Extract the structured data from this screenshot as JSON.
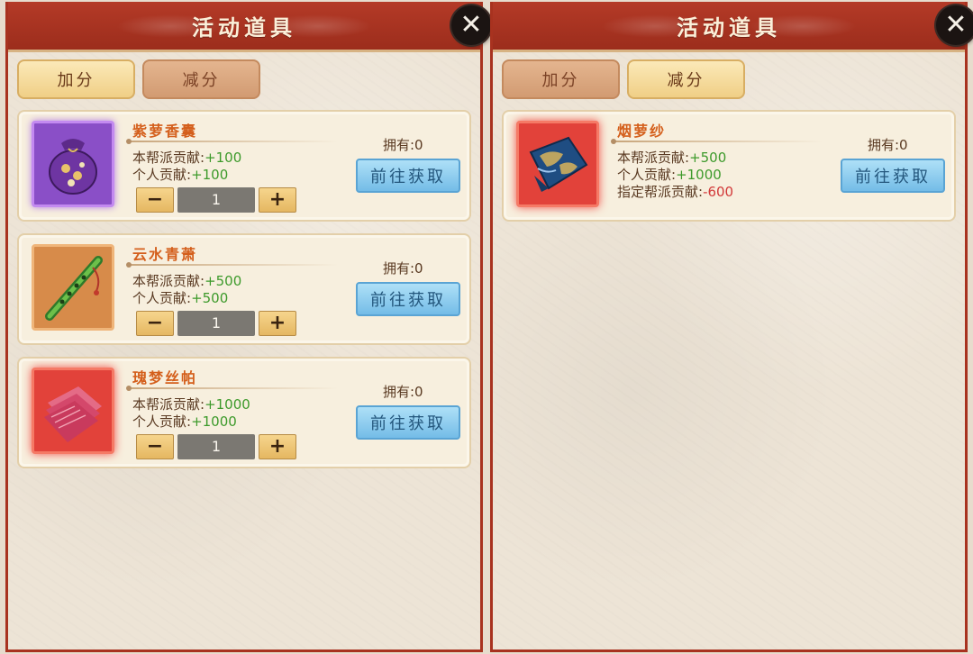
{
  "left_panel": {
    "title": "活动道具",
    "close_symbol": "✕",
    "tabs": [
      {
        "label": "加分",
        "state": "active"
      },
      {
        "label": "减分",
        "state": "inactive"
      }
    ],
    "items": [
      {
        "name": "紫萝香囊",
        "icon": "purple-sachet-icon",
        "stat1_label": "本帮派贡献:",
        "stat1_value": "+100",
        "stat2_label": "个人贡献:",
        "stat2_value": "+100",
        "owned": "拥有:0",
        "button": "前往获取",
        "quantity": "1",
        "minus": "−",
        "plus": "+"
      },
      {
        "name": "云水青萧",
        "icon": "green-flute-icon",
        "stat1_label": "本帮派贡献:",
        "stat1_value": "+500",
        "stat2_label": "个人贡献:",
        "stat2_value": "+500",
        "owned": "拥有:0",
        "button": "前往获取",
        "quantity": "1",
        "minus": "−",
        "plus": "+"
      },
      {
        "name": "瑰梦丝帕",
        "icon": "pink-silk-handkerchief-icon",
        "stat1_label": "本帮派贡献:",
        "stat1_value": "+1000",
        "stat2_label": "个人贡献:",
        "stat2_value": "+1000",
        "owned": "拥有:0",
        "button": "前往获取",
        "quantity": "1",
        "minus": "−",
        "plus": "+"
      }
    ]
  },
  "right_panel": {
    "title": "活动道具",
    "close_symbol": "✕",
    "tabs": [
      {
        "label": "加分",
        "state": "inactive"
      },
      {
        "label": "减分",
        "state": "active"
      }
    ],
    "items": [
      {
        "name": "烟萝纱",
        "icon": "blue-silk-gauze-icon",
        "stat1_label": "本帮派贡献:",
        "stat1_value": "+500",
        "stat2_label": "个人贡献:",
        "stat2_value": "+1000",
        "stat3_label": "指定帮派贡献:",
        "stat3_value": "-600",
        "owned": "拥有:0",
        "button": "前往获取"
      }
    ]
  },
  "colors": {
    "header_red": "#a8321f",
    "name_orange": "#d45f1c",
    "positive_green": "#3d9a2b",
    "negative_red": "#d23a3a",
    "button_blue": "#74bce7"
  }
}
